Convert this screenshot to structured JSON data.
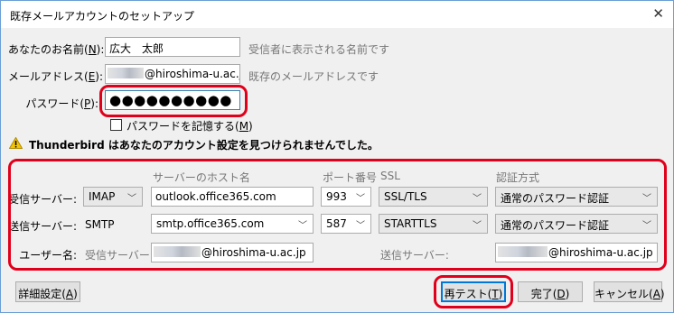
{
  "window": {
    "title": "既存メールアカウントのセットアップ",
    "close_glyph": "✕"
  },
  "identity": {
    "name_label_pre": "あなたのお名前(",
    "name_label_key": "N",
    "name_label_post": "):",
    "name_value": "広大　太郎",
    "name_hint": "受信者に表示される名前です",
    "email_label_pre": "メールアドレス(",
    "email_label_key": "E",
    "email_label_post": "):",
    "email_value": "@hiroshima-u.ac.jp",
    "email_hint": "既存のメールアドレスです",
    "password_label_pre": "パスワード(",
    "password_label_key": "P",
    "password_label_post": "):",
    "password_value": "●●●●●●●●●●",
    "remember_label_pre": "パスワードを記憶する(",
    "remember_label_key": "M",
    "remember_label_post": ")",
    "remember_checked": false
  },
  "warning": {
    "icon": "warning-icon",
    "text": "Thunderbird はあなたのアカウント設定を見つけられませんでした。"
  },
  "server_table": {
    "headers": {
      "hostname": "サーバーのホスト名",
      "port": "ポート番号",
      "ssl": "SSL",
      "auth": "認証方式"
    },
    "incoming": {
      "label": "受信サーバー:",
      "protocol": "IMAP",
      "hostname": "outlook.office365.com",
      "port": "993",
      "ssl": "SSL/TLS",
      "auth": "通常のパスワード認証"
    },
    "outgoing": {
      "label": "送信サーバー:",
      "protocol": "SMTP",
      "hostname": "smtp.office365.com",
      "port": "587",
      "ssl": "STARTTLS",
      "auth": "通常のパスワード認証"
    },
    "username": {
      "label": "ユーザー名:",
      "incoming_label": "受信サーバー:",
      "incoming_value": "@hiroshima-u.ac.jp",
      "outgoing_label": "送信サーバー:",
      "outgoing_value": "@hiroshima-u.ac.jp"
    }
  },
  "buttons": {
    "advanced_pre": "詳細設定(",
    "advanced_key": "A",
    "advanced_post": ")",
    "retest_pre": "再テスト(",
    "retest_key": "T",
    "retest_post": ")",
    "done_pre": "完了(",
    "done_key": "D",
    "done_post": ")",
    "cancel_pre": "キャンセル(",
    "cancel_key": "A",
    "cancel_post": ")"
  },
  "highlight_color": "#e0001b"
}
